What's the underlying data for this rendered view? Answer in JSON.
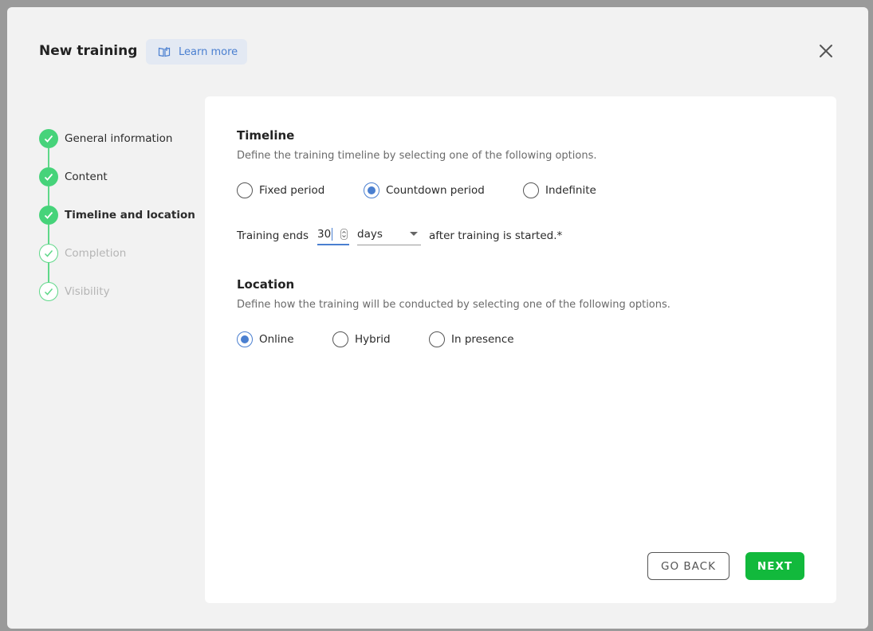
{
  "header": {
    "title": "New training",
    "learn_more_label": "Learn more"
  },
  "stepper": {
    "steps": [
      {
        "label": "General information",
        "status": "done"
      },
      {
        "label": "Content",
        "status": "done"
      },
      {
        "label": "Timeline and location",
        "status": "active"
      },
      {
        "label": "Completion",
        "status": "todo"
      },
      {
        "label": "Visibility",
        "status": "todo"
      }
    ]
  },
  "timeline": {
    "title": "Timeline",
    "description": "Define the training timeline by selecting one of the following options.",
    "options": [
      {
        "label": "Fixed period",
        "selected": false
      },
      {
        "label": "Countdown period",
        "selected": true
      },
      {
        "label": "Indefinite",
        "selected": false
      }
    ],
    "ends_prefix": "Training ends",
    "ends_value": "30",
    "ends_unit": "days",
    "ends_suffix": "after training is started.*"
  },
  "location": {
    "title": "Location",
    "description": "Define how the training will be conducted by selecting one of the following options.",
    "options": [
      {
        "label": "Online",
        "selected": true
      },
      {
        "label": "Hybrid",
        "selected": false
      },
      {
        "label": "In presence",
        "selected": false
      }
    ]
  },
  "actions": {
    "back_label": "GO BACK",
    "next_label": "NEXT"
  },
  "colors": {
    "accent_blue": "#4a7fd0",
    "step_green": "#46d37a",
    "next_green": "#12b93c"
  }
}
